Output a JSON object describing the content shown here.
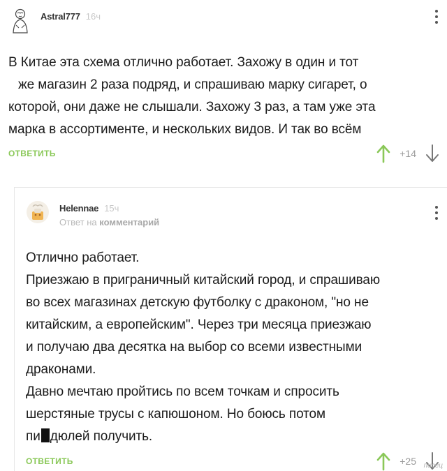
{
  "comments": [
    {
      "username": "Astral777",
      "time": "16ч",
      "lines": [
        "В Китае эта схема отлично работает. Захожу в один и тот",
        "же магазин 2 раза подряд, и спрашиваю марку сигарет, о",
        "которой, они даже не слышали. Захожу 3 раз, а там уже эта",
        "марка в ассортименте, и нескольких видов. И так во всём"
      ],
      "reply_label": "ОТВЕТИТЬ",
      "score": "+14"
    },
    {
      "username": "Helennae",
      "time": "15ч",
      "reply_prefix": "Ответ на",
      "reply_target": "комментарий",
      "lines": [
        "Отлично работает.",
        "Приезжаю в приграничный китайский город, и спрашиваю",
        "во всех магазинах детскую футболку с драконом, \"но не",
        "китайским, а европейским\". Через три месяца приезжаю",
        "и получаю два десятка на выбор со всеми известными",
        "драконами.",
        "Давно мечтаю пройтись по всем точкам и спросить",
        "шерстяные трусы с капюшоном. Но боюсь потом"
      ],
      "last_line_start": "пи",
      "last_line_end": "дюлей получить.",
      "reply_label": "ОТВЕТИТЬ",
      "score": "+25"
    }
  ],
  "watermark": "писец",
  "colors": {
    "accent_green": "#8ac858",
    "muted": "#9a9a9a"
  },
  "icons": {
    "upvote": "arrow-up-icon",
    "downvote": "arrow-down-icon",
    "more": "more-vertical-icon"
  }
}
